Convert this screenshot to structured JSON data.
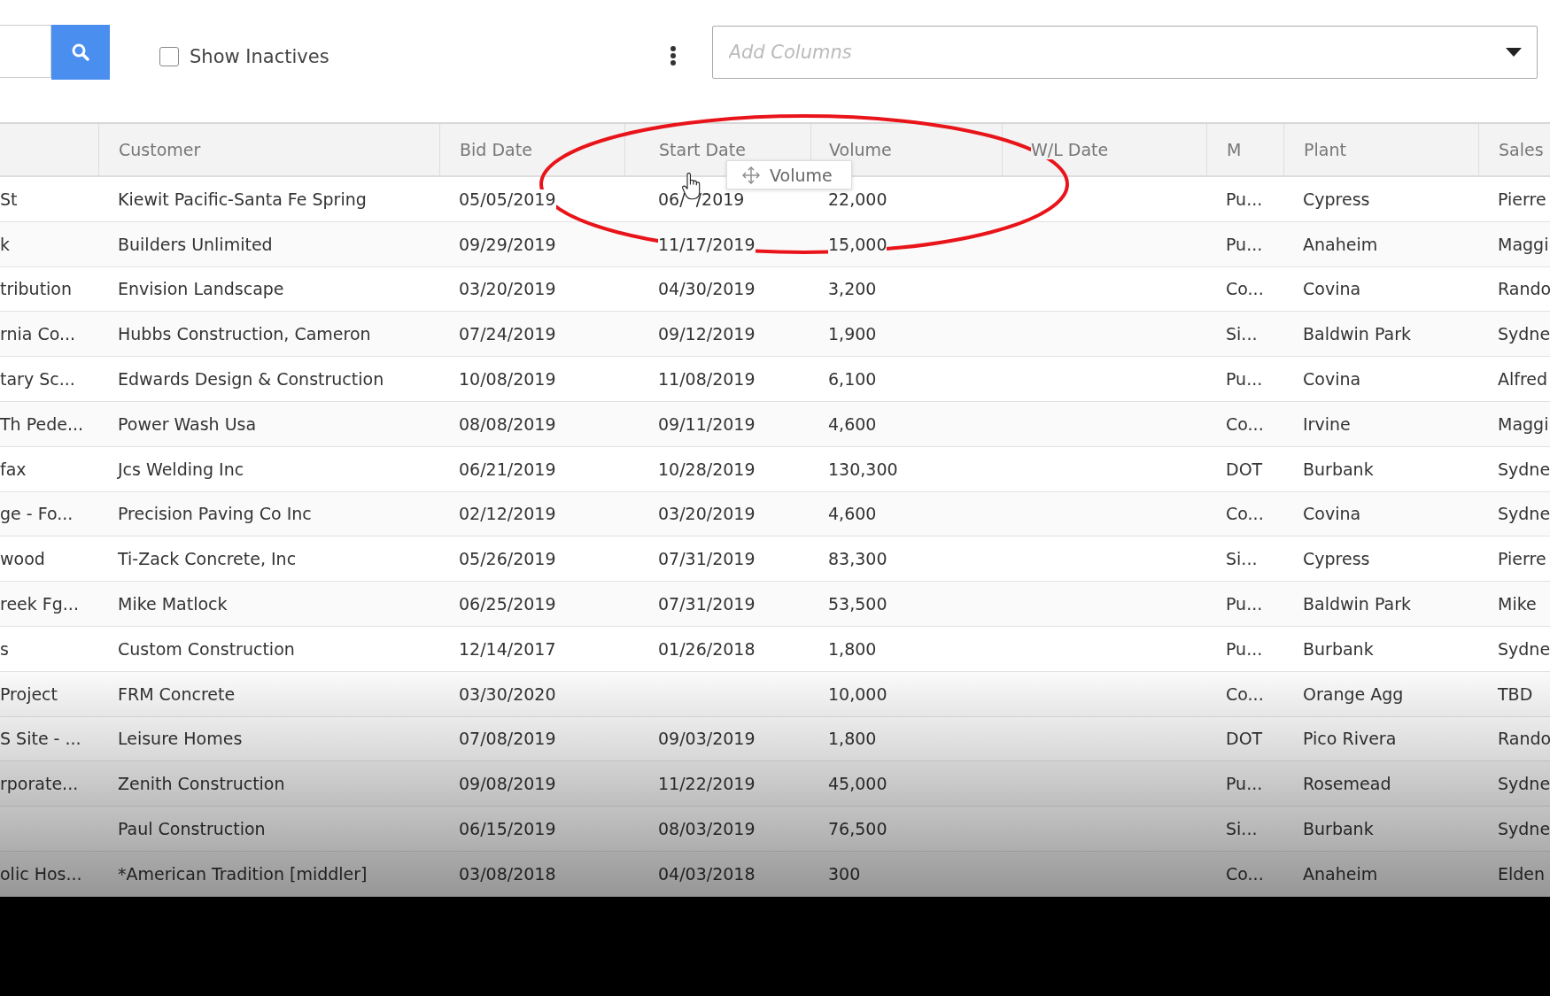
{
  "toolbar": {
    "show_inactives": {
      "label": "Show Inactives",
      "checked": false
    },
    "add_columns": {
      "placeholder": "Add Columns"
    }
  },
  "table": {
    "columns": [
      "",
      "Customer",
      "Bid Date",
      "Start Date",
      "Volume",
      "W/L Date",
      "M",
      "Plant",
      "Sales"
    ],
    "rows": [
      [
        "St",
        "Kiewit Pacific-Santa Fe Spring",
        "05/05/2019",
        "06/  /2019",
        "22,000",
        null,
        "Pu...",
        "Cypress",
        "Pierre"
      ],
      [
        "k",
        "Builders Unlimited",
        "09/29/2019",
        "11/17/2019",
        "15,000",
        null,
        "Pu...",
        "Anaheim",
        "Maggi"
      ],
      [
        "tribution",
        "Envision Landscape",
        "03/20/2019",
        "04/30/2019",
        "3,200",
        null,
        "Co...",
        "Covina",
        "Rando"
      ],
      [
        "rnia Co...",
        "Hubbs Construction, Cameron",
        "07/24/2019",
        "09/12/2019",
        "1,900",
        null,
        "Si...",
        "Baldwin Park",
        "Sydne"
      ],
      [
        "tary Sc...",
        "Edwards Design & Construction",
        "10/08/2019",
        "11/08/2019",
        "6,100",
        null,
        "Pu...",
        "Covina",
        "Alfred"
      ],
      [
        "Th Pede...",
        "Power Wash Usa",
        "08/08/2019",
        "09/11/2019",
        "4,600",
        null,
        "Co...",
        "Irvine",
        "Maggi"
      ],
      [
        "fax",
        "Jcs Welding Inc",
        "06/21/2019",
        "10/28/2019",
        "130,300",
        null,
        "DOT",
        "Burbank",
        "Sydne"
      ],
      [
        "ge - Fo...",
        "Precision Paving Co Inc",
        "02/12/2019",
        "03/20/2019",
        "4,600",
        null,
        "Co...",
        "Covina",
        "Sydne"
      ],
      [
        "wood",
        "Ti-Zack Concrete, Inc",
        "05/26/2019",
        "07/31/2019",
        "83,300",
        null,
        "Si...",
        "Cypress",
        "Pierre"
      ],
      [
        "reek Fg...",
        "Mike Matlock",
        "06/25/2019",
        "07/31/2019",
        "53,500",
        null,
        "Pu...",
        "Baldwin Park",
        "Mike"
      ],
      [
        "s",
        "Custom Construction",
        "12/14/2017",
        "01/26/2018",
        "1,800",
        null,
        "Pu...",
        "Burbank",
        "Sydne"
      ],
      [
        "Project",
        "FRM Concrete",
        "03/30/2020",
        null,
        "10,000",
        null,
        "Co...",
        "Orange Agg",
        "TBD"
      ],
      [
        "S Site - ...",
        "Leisure Homes",
        "07/08/2019",
        "09/03/2019",
        "1,800",
        null,
        "DOT",
        "Pico Rivera",
        "Rando"
      ],
      [
        "rporate...",
        "Zenith Construction",
        "09/08/2019",
        "11/22/2019",
        "45,000",
        null,
        "Pu...",
        "Rosemead",
        "Sydne"
      ],
      [
        null,
        "Paul Construction",
        "06/15/2019",
        "08/03/2019",
        "76,500",
        null,
        "Si...",
        "Burbank",
        "Sydne"
      ],
      [
        "olic Hos...",
        "*American Tradition [middler]",
        "03/08/2018",
        "04/03/2018",
        "300",
        null,
        "Co...",
        "Anaheim",
        "Elden"
      ]
    ]
  },
  "drag_ghost": {
    "label": "Volume"
  }
}
